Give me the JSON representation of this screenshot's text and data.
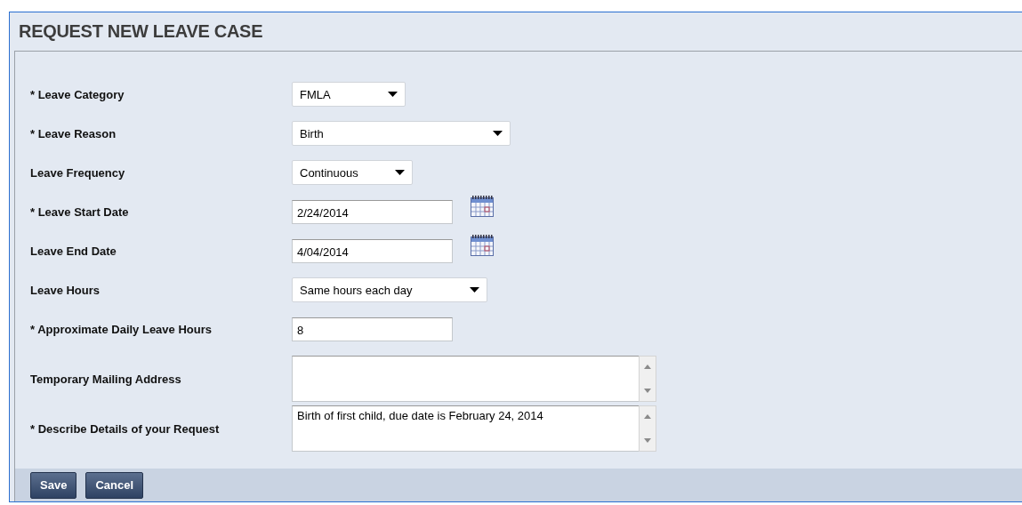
{
  "panel": {
    "title": "REQUEST NEW LEAVE CASE"
  },
  "fields": [
    {
      "label": "* Leave Category",
      "kind": "select",
      "value": "FMLA"
    },
    {
      "label": "* Leave Reason",
      "kind": "select",
      "value": "Birth"
    },
    {
      "label": "Leave Frequency",
      "kind": "select",
      "value": "Continuous"
    },
    {
      "label": "* Leave Start Date",
      "kind": "date",
      "value": "2/24/2014"
    },
    {
      "label": "Leave End Date",
      "kind": "date",
      "value": "4/04/2014"
    },
    {
      "label": "Leave Hours",
      "kind": "select",
      "value": "Same hours each day"
    },
    {
      "label": "* Approximate Daily Leave Hours",
      "kind": "text",
      "value": "8"
    },
    {
      "label": "Temporary Mailing Address",
      "kind": "textarea"
    },
    {
      "label": "* Describe Details of your Request",
      "kind": "textarea",
      "value": "Birth of first child, due date is February 24, 2014"
    }
  ],
  "buttons": [
    "Save",
    "Cancel"
  ]
}
